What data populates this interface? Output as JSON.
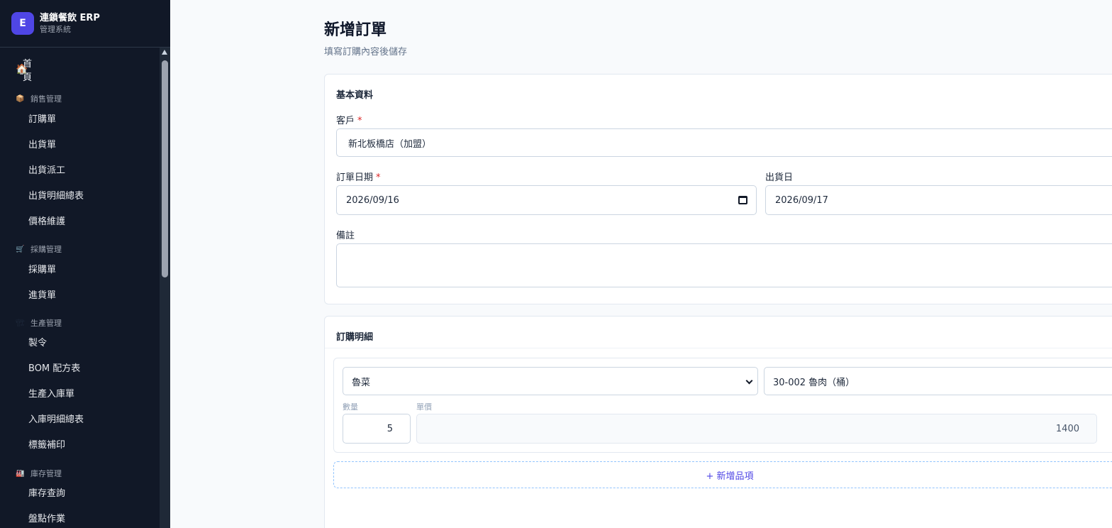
{
  "brand": {
    "logo": "E",
    "title": "連鎖餐飲 ERP",
    "subtitle": "管理系統"
  },
  "nav": {
    "home": {
      "icon": "🏠",
      "label": "首頁"
    },
    "groups": [
      {
        "icon": "📦",
        "label": "銷售管理",
        "items": [
          "訂購單",
          "出貨單",
          "出貨派工",
          "出貨明細總表",
          "價格維護"
        ]
      },
      {
        "icon": "🛒",
        "label": "採購管理",
        "items": [
          "採購單",
          "進貨單"
        ]
      },
      {
        "icon": "🏗",
        "label": "生產管理",
        "items": [
          "製令",
          "BOM 配方表",
          "生產入庫單",
          "入庫明細總表",
          "標籤補印"
        ]
      },
      {
        "icon": "🏭",
        "label": "庫存管理",
        "items": [
          "庫存查詢",
          "盤點作業"
        ]
      }
    ]
  },
  "page": {
    "title": "新增訂單",
    "subtitle": "填寫訂購內容後儲存"
  },
  "basic": {
    "section_title": "基本資料",
    "customer_label": "客戶",
    "required_mark": "*",
    "customer_value": "新北板橋店（加盟）",
    "order_date_label": "訂單日期",
    "order_date_value": "2026/09/16",
    "ship_date_label": "出貨日",
    "ship_date_value": "2026/09/17",
    "note_label": "備註",
    "note_value": ""
  },
  "details": {
    "section_title": "訂購明細",
    "category_value": "魯菜",
    "product_value": "30-002 魯肉（桶）",
    "qty_label": "數量",
    "qty_value": "5",
    "price_label": "單價",
    "price_value": "1400",
    "add_item_label": "+ 新增品項"
  }
}
